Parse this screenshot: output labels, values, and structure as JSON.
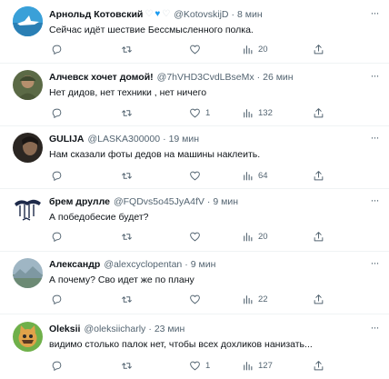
{
  "tweets": [
    {
      "name": "Арнольд Котовский",
      "handle": "@KotovskijD",
      "time": "8 мин",
      "text": "Сейчас идёт шествие Бессмысленного полка.",
      "replies": "",
      "retweets": "",
      "likes": "",
      "views": "20",
      "has_emojis": true,
      "avatar_icon": "shark-avatar"
    },
    {
      "name": "Алчевск хочет домой!",
      "handle": "@7hVHD3CvdLBseMx",
      "time": "26 мин",
      "text": "Нет дидов, нет техники , нет ничего",
      "replies": "",
      "retweets": "",
      "likes": "1",
      "views": "132",
      "has_emojis": false,
      "avatar_icon": "soldier-avatar"
    },
    {
      "name": "GULIJA",
      "handle": "@LASKA300000",
      "time": "19 мин",
      "text": "Нам сказали фоты дедов на машины наклеить.",
      "replies": "",
      "retweets": "",
      "likes": "",
      "views": "64",
      "has_emojis": false,
      "avatar_icon": "dark-portrait-avatar"
    },
    {
      "name": "брем друлле",
      "handle": "@FQDvs5o45JyA4fV",
      "time": "9 мин",
      "text": "А победобесие будет?",
      "replies": "",
      "retweets": "",
      "likes": "",
      "views": "20",
      "has_emojis": false,
      "avatar_icon": "tree-avatar"
    },
    {
      "name": "Александр",
      "handle": "@alexcyclopentan",
      "time": "9 мин",
      "text": "А почему? Сво идет же по плану",
      "replies": "",
      "retweets": "",
      "likes": "",
      "views": "22",
      "has_emojis": false,
      "avatar_icon": "landscape-avatar"
    },
    {
      "name": "Oleksii",
      "handle": "@oleksiicharly",
      "time": "23 мин",
      "text": "видимо столько палок нет, чтобы всех дохликов нанизать...",
      "replies": "",
      "retweets": "",
      "likes": "1",
      "views": "127",
      "has_emojis": false,
      "avatar_icon": "cat-avatar"
    }
  ],
  "colors": {
    "text": "#0f1419",
    "secondary": "#536471",
    "divider": "#eff3f4",
    "accent": "#1d9bf0"
  }
}
